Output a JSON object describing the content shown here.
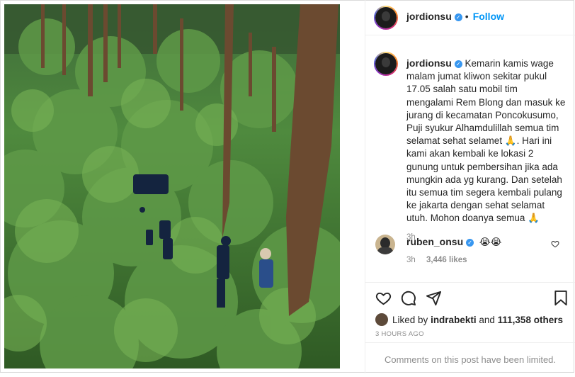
{
  "post": {
    "author": "jordionsu",
    "verified": true,
    "follow_label": "Follow",
    "separator": "•",
    "more_label": "•••",
    "caption": "Kemarin kamis wage malam jumat kliwon sekitar pukul 17.05 salah satu mobil tim mengalami Rem Blong dan masuk ke jurang di kecamatan Poncokusumo, Puji syukur Alhamdulillah semua tim selamat sehat selamet 🙏. Hari ini kami akan kembali ke lokasi 2 gunung untuk pembersihan jika ada mungkin ada yg kurang. Dan setelah itu semua tim segera kembali pulang ke jakarta dengan sehat selamat utuh. Mohon doanya semua 🙏",
    "caption_time": "3h"
  },
  "comment": {
    "author": "ruben_onsu",
    "verified": true,
    "text": "😭😭",
    "time": "3h",
    "likes": "3,446 likes"
  },
  "actions": {
    "like_icon": "heart-icon",
    "comment_icon": "comment-icon",
    "share_icon": "send-icon",
    "save_icon": "bookmark-icon"
  },
  "likes": {
    "prefix": "Liked by",
    "user": "indrabekti",
    "connector": "and",
    "count": "111,358 others"
  },
  "post_time": "3 HOURS AGO",
  "comments_limited": "Comments on this post have been limited.",
  "colors": {
    "follow": "#0095f6",
    "verified": "#3897f0",
    "muted": "#8e8e8e"
  }
}
